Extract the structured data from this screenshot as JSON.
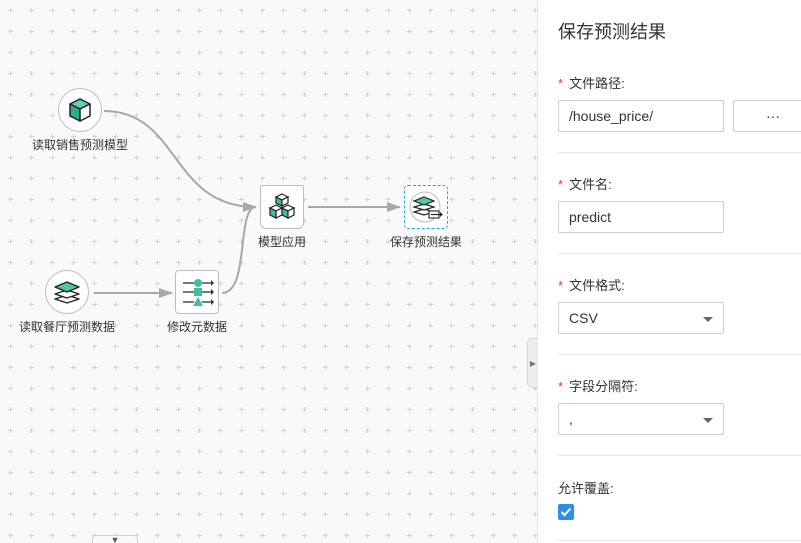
{
  "canvas": {
    "nodes": {
      "read_model": {
        "label": "读取销售预测模型",
        "icon": "cube-icon"
      },
      "read_data": {
        "label": "读取餐厅预测数据",
        "icon": "layers-icon"
      },
      "modify_meta": {
        "label": "修改元数据",
        "icon": "metadata-icon"
      },
      "apply_model": {
        "label": "模型应用",
        "icon": "cubes-icon"
      },
      "save_result": {
        "label": "保存预测结果",
        "icon": "save-layers-icon"
      }
    },
    "collapse_toggle": "▼",
    "splitter_toggle": "▶"
  },
  "panel": {
    "title": "保存预测结果",
    "required_mark": "*",
    "file_path": {
      "label": "文件路径:",
      "value": "/house_price/",
      "browse_label": "···"
    },
    "file_name": {
      "label": "文件名:",
      "value": "predict"
    },
    "file_format": {
      "label": "文件格式:",
      "value": "CSV"
    },
    "field_separator": {
      "label": "字段分隔符:",
      "value": ","
    },
    "allow_overwrite": {
      "label": "允许覆盖:",
      "checked": true
    }
  },
  "colors": {
    "accent_teal": "#3fbfa0",
    "checkbox_blue": "#2d8ee6",
    "required_red": "#e0393e",
    "selected_border": "#21a8d8"
  }
}
